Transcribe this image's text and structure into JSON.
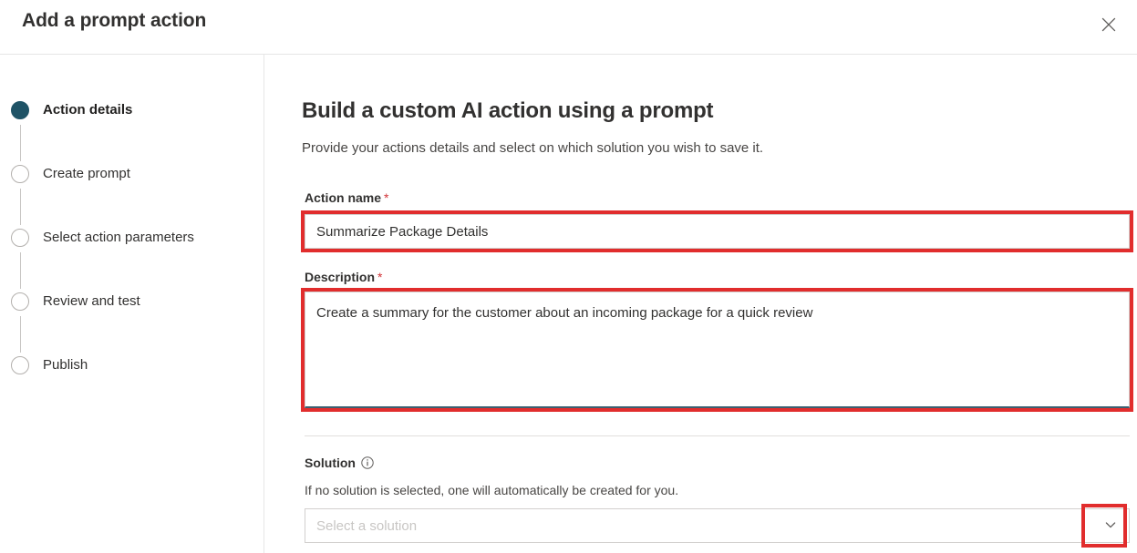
{
  "dialog": {
    "title": "Add a prompt action",
    "close_icon": "close-icon"
  },
  "sidebar": {
    "steps": [
      {
        "label": "Action details",
        "state": "active"
      },
      {
        "label": "Create prompt",
        "state": "inactive"
      },
      {
        "label": "Select action parameters",
        "state": "inactive"
      },
      {
        "label": "Review and test",
        "state": "inactive"
      },
      {
        "label": "Publish",
        "state": "inactive"
      }
    ]
  },
  "main": {
    "heading": "Build a custom AI action using a prompt",
    "subheading": "Provide your actions details and select on which solution you wish to save it.",
    "fields": {
      "action_name": {
        "label": "Action name",
        "required_marker": "*",
        "value": "Summarize Package Details",
        "placeholder": ""
      },
      "description": {
        "label": "Description",
        "required_marker": "*",
        "value": "Create a summary for the customer about an incoming package for a quick review",
        "placeholder": ""
      },
      "solution": {
        "label": "Solution",
        "info_icon": "info-icon",
        "helper_text": "If no solution is selected, one will automatically be created for you.",
        "value": "",
        "placeholder": "Select a solution",
        "chevron_icon": "chevron-down-icon"
      }
    }
  },
  "colors": {
    "annotation_red": "#e12d2d",
    "active_step": "#1f5366",
    "required_red": "#d13438",
    "focus_underline": "#3b5f70"
  }
}
